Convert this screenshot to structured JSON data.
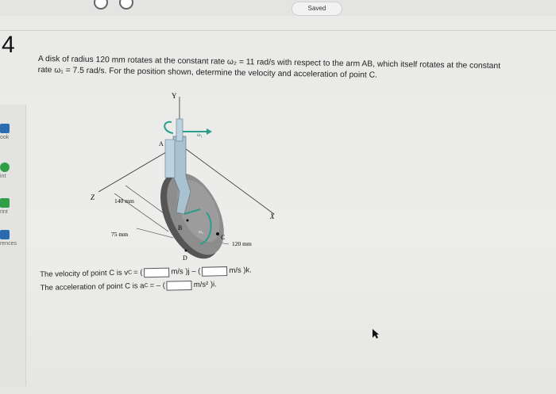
{
  "header": {
    "saved_label": "Saved"
  },
  "question": {
    "number": "4"
  },
  "sidebar": {
    "items": [
      {
        "label": "ook",
        "color": "#2b6cb0"
      },
      {
        "label": "int",
        "color": "#2f9e44"
      },
      {
        "label": "rint",
        "color": "#2f9e44"
      },
      {
        "label": "rences",
        "color": "#2b6cb0"
      }
    ]
  },
  "problem": {
    "line1": "A disk of radius 120 mm rotates at the constant rate ω₂ = 11 rad/s with respect to the arm AB, which itself rotates at the constant",
    "line2": "rate ω₁ = 7.5 rad/s. For the position shown, determine the velocity and acceleration of point C."
  },
  "figure": {
    "label_y": "Y",
    "label_x": "X",
    "label_z": "Z",
    "label_a": "A",
    "label_b": "B",
    "label_c": "C",
    "label_d": "D",
    "label_w1": "ω₁",
    "label_w2": "ω₂",
    "dim_140": "140 mm",
    "dim_75": "75 mm",
    "dim_120": "120 mm"
  },
  "answers": {
    "velocity_prefix": "The velocity of point C is v",
    "velocity_sub": "C",
    "velocity_eq": "= (",
    "velocity_unit1": "m/s )j – (",
    "velocity_unit2": "m/s )k.",
    "accel_prefix": "The acceleration of point C is a",
    "accel_sub": "C",
    "accel_eq": "= – (",
    "accel_unit": "m/s² )i."
  }
}
